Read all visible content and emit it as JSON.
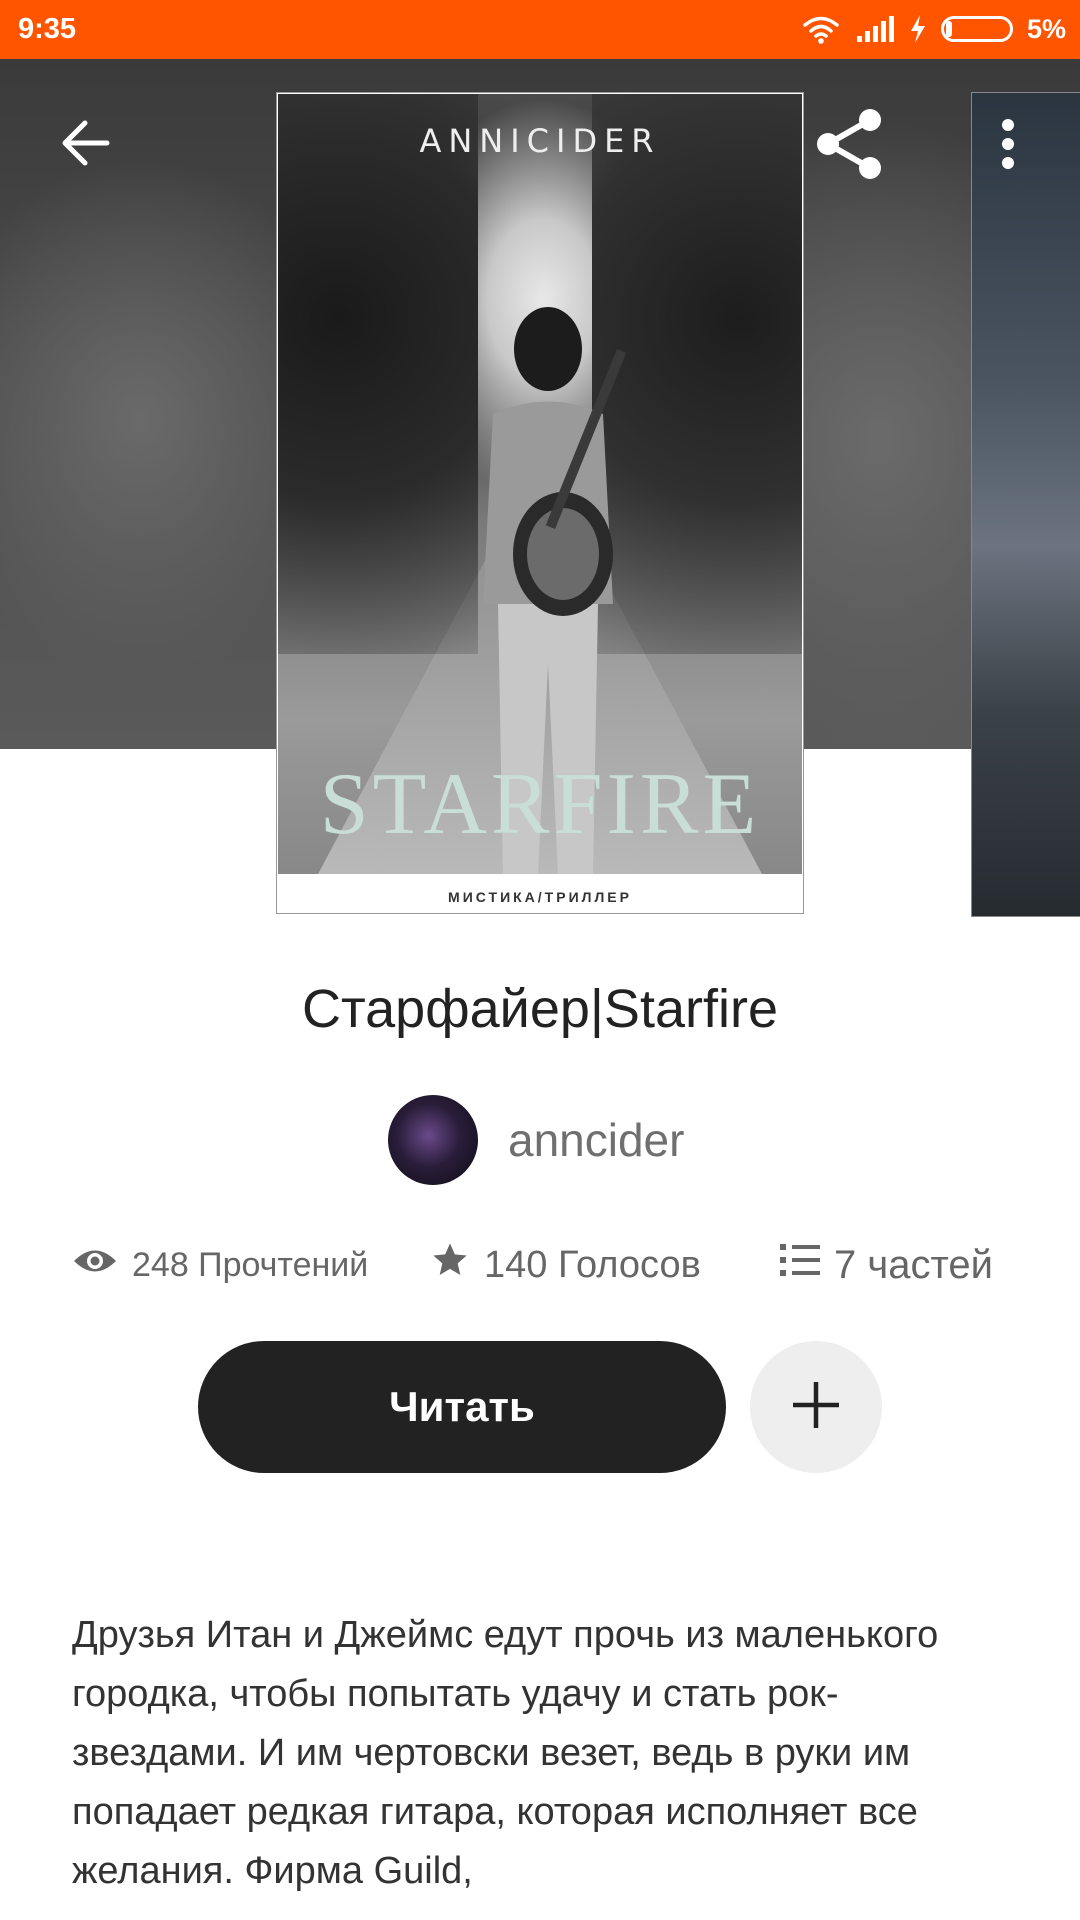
{
  "status_bar": {
    "time": "9:35",
    "battery": "5%",
    "icons": [
      "wifi-icon",
      "signal-icon",
      "charging-icon",
      "battery-icon"
    ]
  },
  "toolbar": {
    "icons": [
      "back-arrow-icon",
      "share-icon",
      "more-vert-icon"
    ]
  },
  "cover": {
    "author": "ANNICIDER",
    "title": "STARFIRE",
    "genre": "МИСТИКА/ТРИЛЛЕР"
  },
  "story": {
    "title": "Старфайер|Starfire",
    "author": "anncider"
  },
  "stats": {
    "reads": "248 Прочтений",
    "votes": "140 Голосов",
    "parts": "7 частей"
  },
  "actions": {
    "read_label": "Читать"
  },
  "description": "Друзья Итан и Джеймс едут прочь из маленького городка, чтобы попытать удачу и стать рок-звездами. И им чертовски везет, ведь в руки им попадает редкая гитара, которая исполняет все желания. Фирма Guild,",
  "colors": {
    "status_bar": "#ff5500",
    "read_button": "#222222",
    "add_button": "#eeeeee"
  }
}
